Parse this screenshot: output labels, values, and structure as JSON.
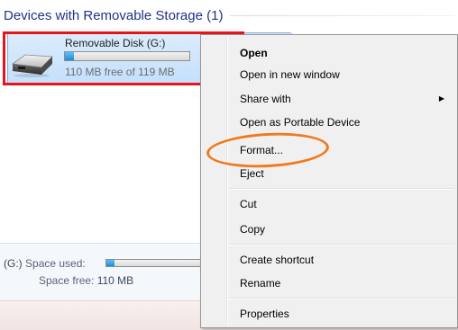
{
  "group": {
    "title": "Devices with Removable Storage (1)"
  },
  "drive": {
    "name": "Removable Disk (G:)",
    "free_text": "110 MB free of 119 MB",
    "used_fraction": 0.076,
    "icon": "removable-disk-icon"
  },
  "details": {
    "drive_letter": "(G:)",
    "space_used_label": "Space used:",
    "space_free_label": "Space free:",
    "space_free_value": "110 MB",
    "used_fraction": 0.076
  },
  "context_menu": {
    "open": "Open",
    "open_new_window": "Open in new window",
    "share_with": "Share with",
    "share_arrow": "▶",
    "open_portable": "Open as Portable Device",
    "format": "Format...",
    "eject": "Eject",
    "cut": "Cut",
    "copy": "Copy",
    "create_shortcut": "Create shortcut",
    "rename": "Rename",
    "properties": "Properties"
  },
  "colors": {
    "highlight_rect": "#e8141c",
    "highlight_ellipse": "#f07a1e",
    "group_title": "#1e3287",
    "selection": "#c4e0fc"
  }
}
